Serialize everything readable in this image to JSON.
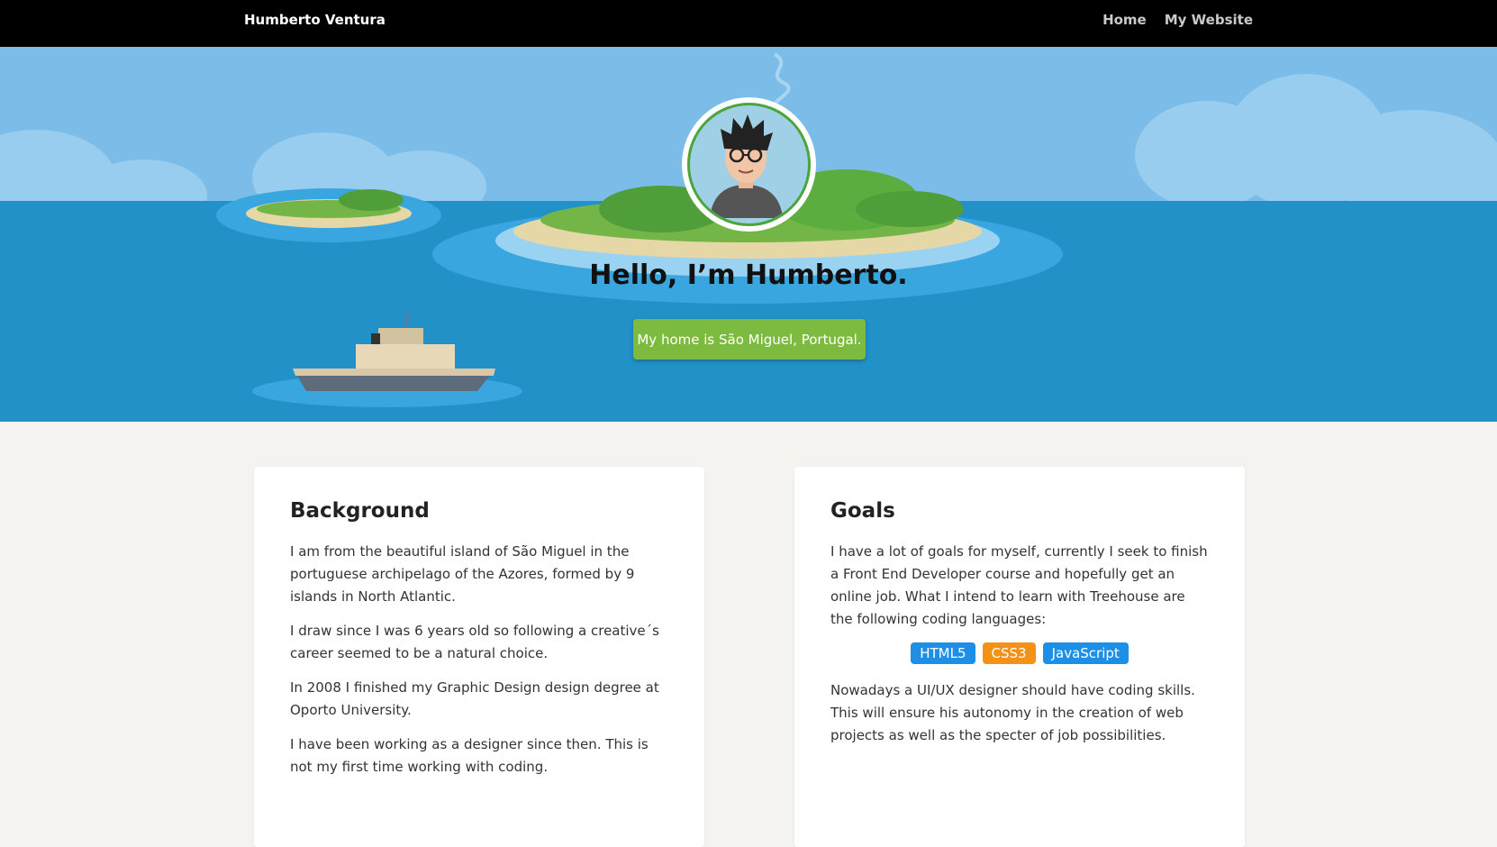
{
  "nav": {
    "brand": "Humberto Ventura",
    "links": [
      "Home",
      "My Website"
    ]
  },
  "hero": {
    "title": "Hello, I’m Humberto.",
    "button_label": "My home is São Miguel, Portugal."
  },
  "background": {
    "heading": "Background",
    "paragraphs": [
      "I am from the beautiful island of São Miguel in the portuguese archipelago of the Azores, formed by 9 islands in North Atlantic.",
      "I draw since I was 6 years old so following a creative´s career seemed to be a natural choice.",
      "In 2008 I finished my Graphic Design design degree at Oporto University.",
      "I have been working as a designer since then. This is not my first time working with coding."
    ]
  },
  "goals": {
    "heading": "Goals",
    "intro": "I have a lot of goals for myself, currently I seek to finish a Front End Developer course and hopefully get an online job. What I intend to learn with Treehouse are the following coding languages:",
    "tags": [
      {
        "label": "HTML5",
        "color": "#1e8fe6"
      },
      {
        "label": "CSS3",
        "color": "#f39217"
      },
      {
        "label": "JavaScript",
        "color": "#1e8fe6"
      }
    ],
    "outro": "Nowadays a UI/UX designer should have coding skills. This will ensure his autonomy in the creation of web projects as well as the specter of job possibilities."
  },
  "colors": {
    "sky": "#7bbde8",
    "sea": "#2291c7",
    "button": "#7cbb3f",
    "page_bg": "#f4f3ef"
  }
}
